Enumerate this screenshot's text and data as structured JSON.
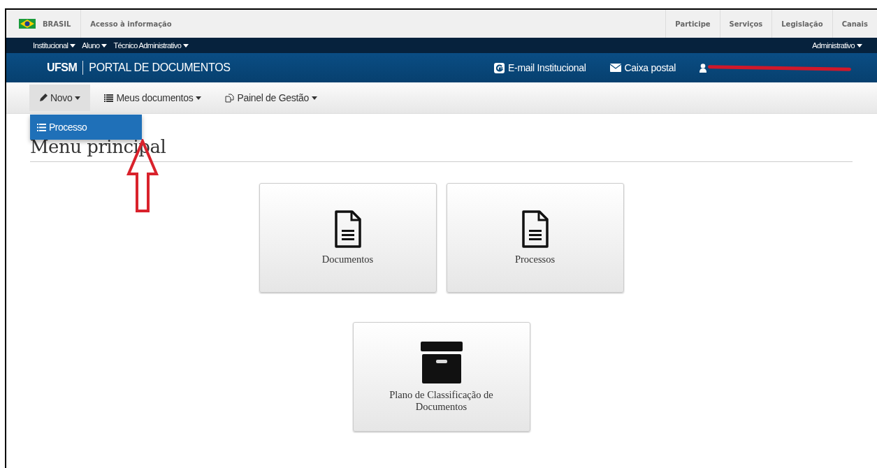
{
  "gov_bar": {
    "country": "BRASIL",
    "link": "Acesso à informação",
    "items": [
      "Participe",
      "Serviços",
      "Legislação",
      "Canais"
    ]
  },
  "audience_menu": {
    "left": [
      "Institucional",
      "Aluno",
      "Técnico Administrativo"
    ],
    "right": [
      "Administrativo"
    ]
  },
  "header": {
    "brand": "UFSM",
    "title": "PORTAL DE DOCUMENTOS",
    "links": [
      {
        "kind": "email",
        "label": "E-mail Institucional"
      },
      {
        "kind": "mail",
        "label": "Caixa postal"
      }
    ],
    "user": {
      "redacted": true
    }
  },
  "nav": [
    {
      "kind": "pencil",
      "label": "Novo",
      "selected": true
    },
    {
      "kind": "list",
      "label": "Meus documentos",
      "selected": false
    },
    {
      "kind": "copy",
      "label": "Painel de Gestão",
      "selected": false
    }
  ],
  "dropdown": [
    {
      "label": "Processo",
      "selected": true
    }
  ],
  "heading": "Menu principal",
  "cards": [
    {
      "kind": "document",
      "label": "Documentos"
    },
    {
      "kind": "document",
      "label": "Processos"
    },
    {
      "kind": "archive",
      "label": "Plano de Classificação de Documentos"
    }
  ]
}
